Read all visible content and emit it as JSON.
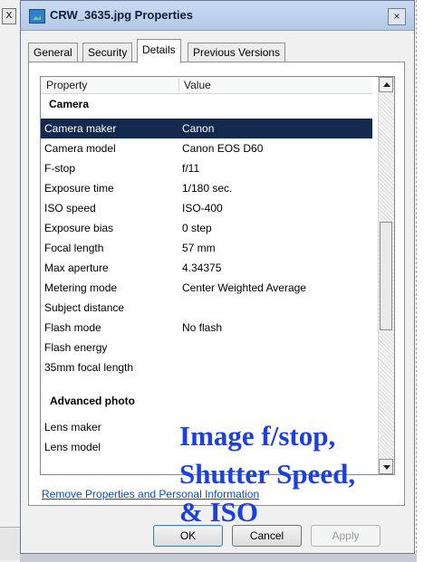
{
  "window": {
    "title": "CRW_3635.jpg Properties",
    "close_glyph": "×"
  },
  "background": {
    "fragment_glyph": "X"
  },
  "tabs": [
    {
      "label": "General"
    },
    {
      "label": "Security"
    },
    {
      "label": "Details"
    },
    {
      "label": "Previous Versions"
    }
  ],
  "list": {
    "columns": {
      "property": "Property",
      "value": "Value"
    },
    "groups": {
      "camera": "Camera",
      "advanced": "Advanced photo"
    },
    "rows": [
      {
        "property": "Camera maker",
        "value": "Canon"
      },
      {
        "property": "Camera model",
        "value": "Canon EOS D60"
      },
      {
        "property": "F-stop",
        "value": "f/11"
      },
      {
        "property": "Exposure time",
        "value": "1/180 sec."
      },
      {
        "property": "ISO speed",
        "value": "ISO-400"
      },
      {
        "property": "Exposure bias",
        "value": "0 step"
      },
      {
        "property": "Focal length",
        "value": "57 mm"
      },
      {
        "property": "Max aperture",
        "value": "4.34375"
      },
      {
        "property": "Metering mode",
        "value": "Center Weighted Average"
      },
      {
        "property": "Subject distance",
        "value": ""
      },
      {
        "property": "Flash mode",
        "value": "No flash"
      },
      {
        "property": "Flash energy",
        "value": ""
      },
      {
        "property": "35mm focal length",
        "value": ""
      }
    ],
    "rows_after": [
      {
        "property": "Lens maker",
        "value": ""
      },
      {
        "property": "Lens model",
        "value": ""
      }
    ],
    "selected_index": 0
  },
  "overlay": {
    "line1": "Image f/stop,",
    "line2": "Shutter Speed,",
    "line3": "& ISO",
    "color": "#1c3fe0"
  },
  "remove_link": "Remove Properties and Personal Information",
  "buttons": {
    "ok": "OK",
    "cancel": "Cancel",
    "apply": "Apply"
  },
  "colors": {
    "selection": "#13294e",
    "link": "#0a4fb8"
  }
}
